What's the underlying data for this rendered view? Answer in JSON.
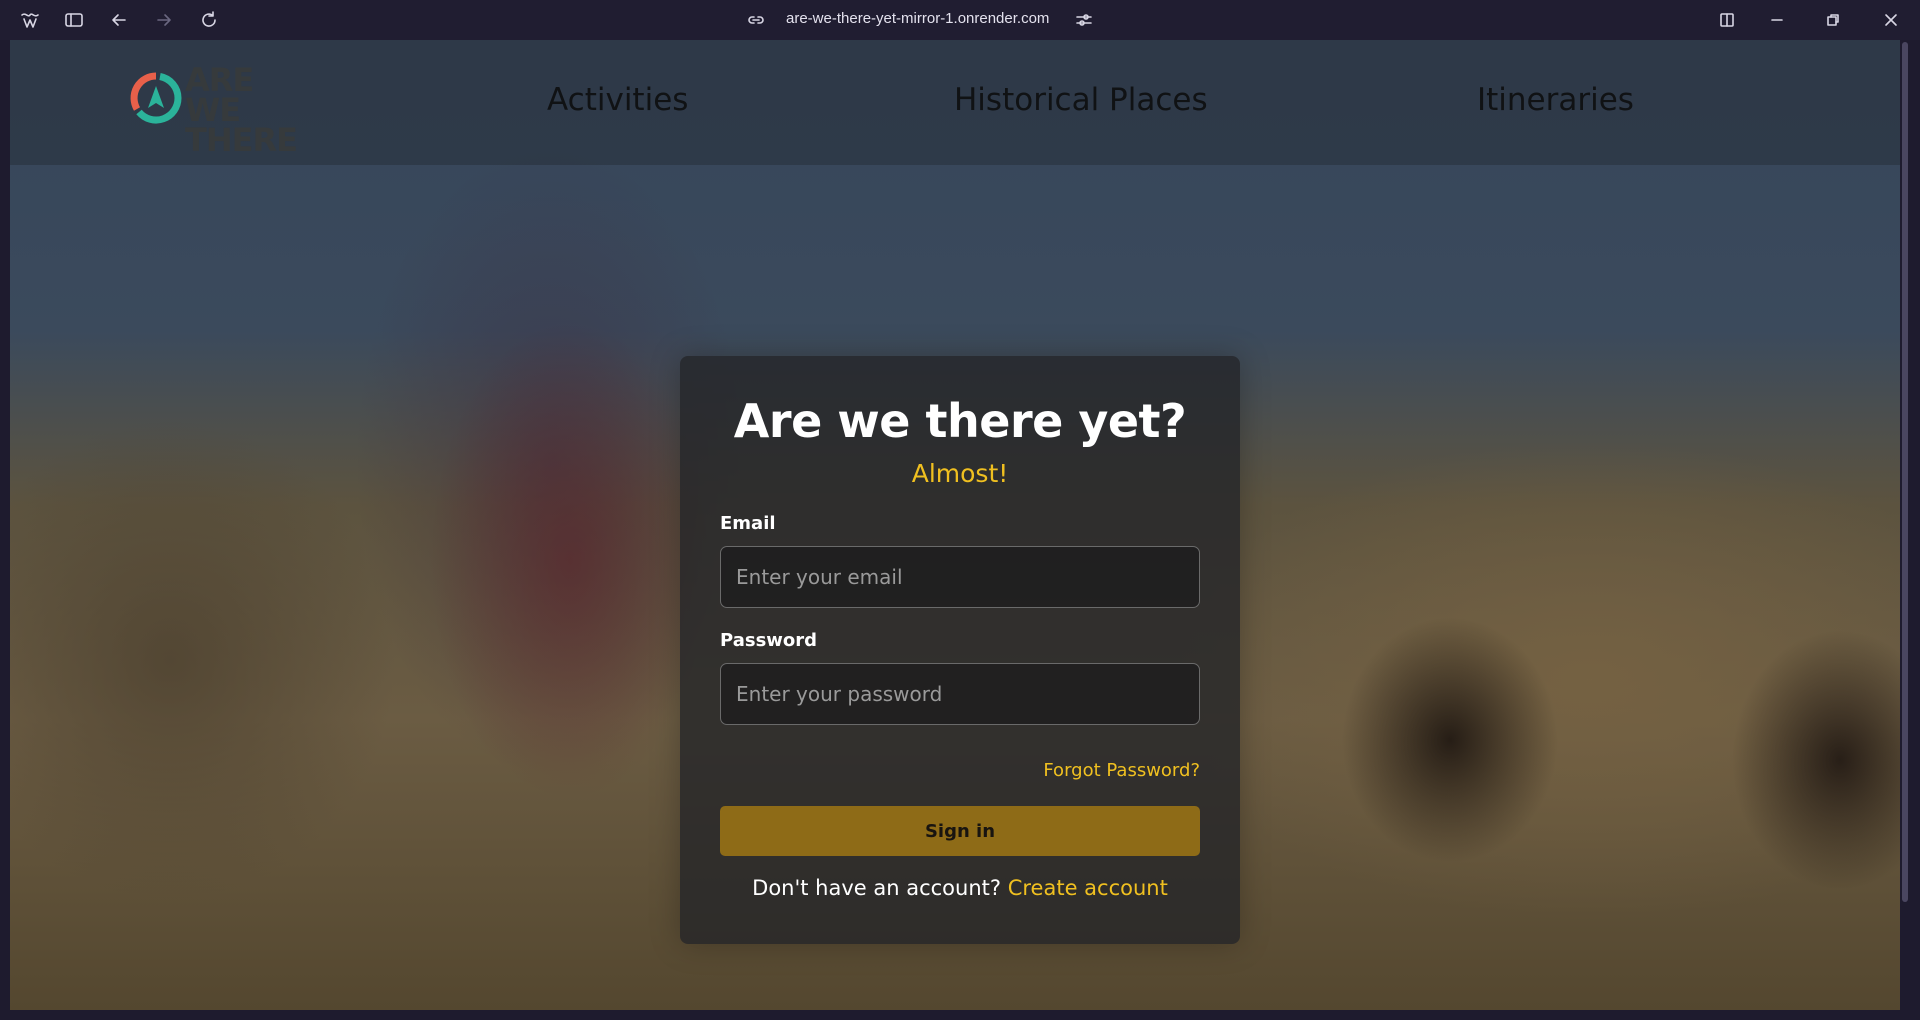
{
  "browser": {
    "url": "are-we-there-yet-mirror-1.onrender.com",
    "icons": [
      "app-menu-icon",
      "sidebar-icon",
      "back-icon",
      "forward-icon",
      "reload-icon",
      "link-icon",
      "site-settings-icon",
      "split-view-icon",
      "minimize-icon",
      "restore-icon",
      "close-icon"
    ]
  },
  "navbar": {
    "logo_text_line1": "ARE WE",
    "logo_text_line2": "THERE",
    "links": [
      "Activities",
      "Historical Places",
      "Itineraries"
    ]
  },
  "login": {
    "title": "Are we there yet?",
    "subtitle": "Almost!",
    "email_label": "Email",
    "email_placeholder": "Enter your email",
    "email_value": "",
    "password_label": "Password",
    "password_placeholder": "Enter your password",
    "password_value": "",
    "forgot_password": "Forgot Password?",
    "signin_label": "Sign in",
    "no_account_text": "Don't have an account?",
    "create_account": "Create account"
  },
  "colors": {
    "accent": "#f0c020",
    "button": "#8e6b17",
    "logo_orange": "#e8604a",
    "logo_teal": "#2bb39a"
  }
}
